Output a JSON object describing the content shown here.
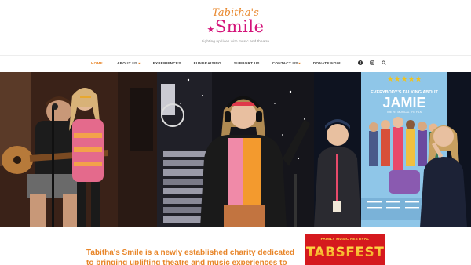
{
  "logo": {
    "top": "Tabitha's",
    "main": "Smile",
    "tagline": "Lighting up lives with music and theatre"
  },
  "nav": {
    "items": [
      {
        "label": "HOME",
        "active": true,
        "dropdown": false
      },
      {
        "label": "ABOUT US",
        "active": false,
        "dropdown": true
      },
      {
        "label": "EXPERIENCES",
        "active": false,
        "dropdown": false
      },
      {
        "label": "FUNDRAISING",
        "active": false,
        "dropdown": false
      },
      {
        "label": "SUPPORT US",
        "active": false,
        "dropdown": false
      },
      {
        "label": "CONTACT US",
        "active": false,
        "dropdown": true
      },
      {
        "label": "DONATE NOW!",
        "active": false,
        "dropdown": false
      }
    ],
    "socials": [
      "facebook-icon",
      "instagram-icon",
      "search-icon"
    ]
  },
  "poster": {
    "stars": "★★★★★",
    "title_small": "EVERYBODY'S TALKING ABOUT",
    "title_big": "JAMIE",
    "subtitle": "THE HIT MUSICAL THE FILM"
  },
  "intro": {
    "line1": "Tabitha's Smile is a newly established charity dedicated",
    "line2": "to bringing uplifting theatre and music experiences to"
  },
  "badge": {
    "sub": "FAMILY MUSIC FESTIVAL",
    "main": "TABSFEST"
  },
  "colors": {
    "accent": "#e8862a",
    "brand": "#d4147a",
    "badge": "#d5191e"
  }
}
